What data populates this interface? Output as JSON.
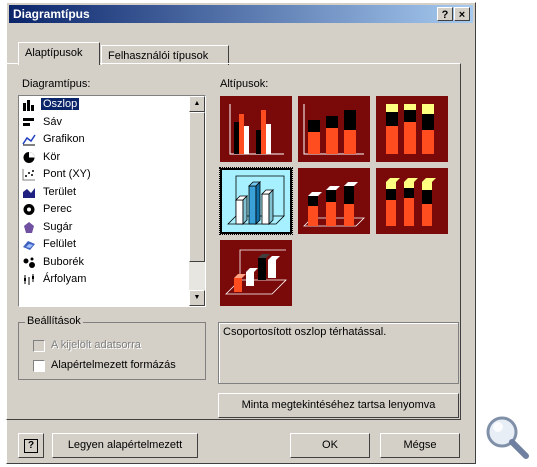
{
  "window": {
    "title": "Diagramtípus",
    "help_label": "?",
    "close_label": "×"
  },
  "tabs": [
    {
      "label": "Alaptípusok",
      "active": true
    },
    {
      "label": "Felhasználói típusok",
      "active": false
    }
  ],
  "chart_type_label": "Diagramtípus:",
  "chart_types": [
    {
      "label": "Oszlop",
      "icon": "column-chart-icon",
      "selected": true
    },
    {
      "label": "Sáv",
      "icon": "bar-chart-icon"
    },
    {
      "label": "Grafikon",
      "icon": "line-chart-icon"
    },
    {
      "label": "Kör",
      "icon": "pie-chart-icon"
    },
    {
      "label": "Pont (XY)",
      "icon": "scatter-chart-icon"
    },
    {
      "label": "Terület",
      "icon": "area-chart-icon"
    },
    {
      "label": "Perec",
      "icon": "doughnut-chart-icon"
    },
    {
      "label": "Sugár",
      "icon": "radar-chart-icon"
    },
    {
      "label": "Felület",
      "icon": "surface-chart-icon"
    },
    {
      "label": "Buborék",
      "icon": "bubble-chart-icon"
    },
    {
      "label": "Árfolyam",
      "icon": "stock-chart-icon"
    }
  ],
  "subtype_label": "Altípusok:",
  "subtypes": [
    {
      "name": "clustered-column",
      "selected": false
    },
    {
      "name": "stacked-column",
      "selected": false
    },
    {
      "name": "100-stacked-column",
      "selected": false
    },
    {
      "name": "clustered-column-3d-effect",
      "selected": true
    },
    {
      "name": "stacked-column-3d-effect",
      "selected": false
    },
    {
      "name": "100-stacked-column-3d-effect",
      "selected": false
    },
    {
      "name": "3d-column",
      "selected": false
    }
  ],
  "options": {
    "title": "Beállítások",
    "apply_to_selection": "A kijelölt adatsorra",
    "default_formatting": "Alapértelmezett formázás"
  },
  "description": "Csoportosított oszlop térhatással.",
  "buttons": {
    "preview": "Minta megtekintéséhez tartsa lenyomva",
    "set_default": "Legyen alapértelmezett",
    "ok": "OK",
    "cancel": "Mégse"
  },
  "colors": {
    "subtype_bg": "#7a0a0a",
    "selected_bg": "#a7f0ff",
    "titlebar": "#0a246a"
  }
}
